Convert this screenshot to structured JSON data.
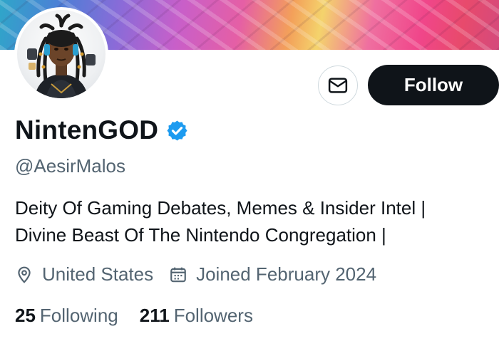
{
  "profile": {
    "display_name": "NintenGOD",
    "handle": "@AesirMalos",
    "bio_line1": "Deity Of Gaming Debates, Memes & Insider Intel |",
    "bio_line2": "Divine Beast Of The Nintendo Congregation |",
    "location": "United States",
    "joined": "Joined February 2024",
    "verified": true
  },
  "actions": {
    "follow_label": "Follow",
    "message_icon": "envelope-icon"
  },
  "stats": {
    "following_count": "25",
    "following_label": "Following",
    "followers_count": "211",
    "followers_label": "Followers"
  },
  "icons": {
    "location": "map-pin-icon",
    "joined": "calendar-icon",
    "verified": "verified-badge-icon"
  },
  "colors": {
    "text_primary": "#0f1419",
    "text_secondary": "#536471",
    "verified_blue": "#1d9bf0",
    "button_dark": "#0f1419"
  }
}
